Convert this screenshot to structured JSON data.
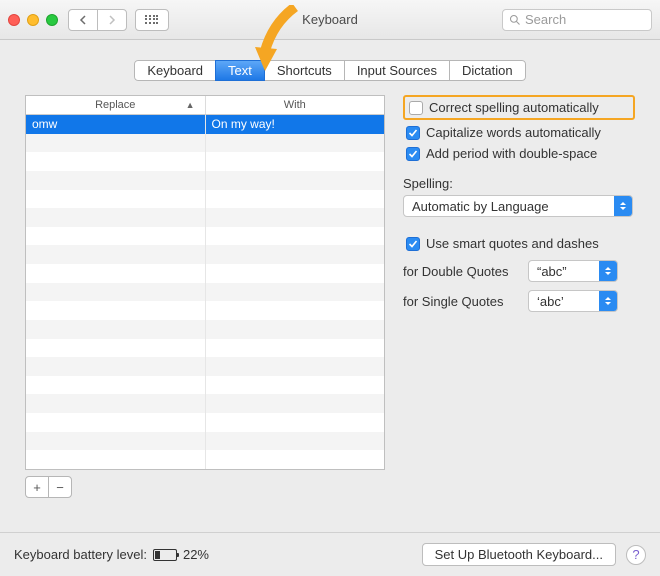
{
  "window": {
    "title": "Keyboard"
  },
  "search": {
    "placeholder": "Search"
  },
  "tabs": {
    "items": [
      "Keyboard",
      "Text",
      "Shortcuts",
      "Input Sources",
      "Dictation"
    ],
    "active": "Text"
  },
  "table": {
    "headers": {
      "replace": "Replace",
      "with": "With"
    },
    "rows": [
      {
        "replace": "omw",
        "with": "On my way!",
        "selected": true
      }
    ]
  },
  "buttons": {
    "add": "+",
    "remove": "−"
  },
  "options": {
    "correct_spelling": {
      "label": "Correct spelling automatically",
      "checked": false,
      "highlighted": true
    },
    "capitalize": {
      "label": "Capitalize words automatically",
      "checked": true
    },
    "add_period": {
      "label": "Add period with double-space",
      "checked": true
    },
    "spelling_label": "Spelling:",
    "spelling_value": "Automatic by Language",
    "smart_quotes": {
      "label": "Use smart quotes and dashes",
      "checked": true
    },
    "double_quotes_label": "for Double Quotes",
    "double_quotes_value": "“abc”",
    "single_quotes_label": "for Single Quotes",
    "single_quotes_value": "‘abc’"
  },
  "footer": {
    "battery_label": "Keyboard battery level:",
    "battery_percent": "22%",
    "bt_button": "Set Up Bluetooth Keyboard...",
    "help": "?"
  },
  "colors": {
    "highlight": "#f5a623",
    "accent": "#2a8bf2",
    "selection": "#1177e9"
  }
}
